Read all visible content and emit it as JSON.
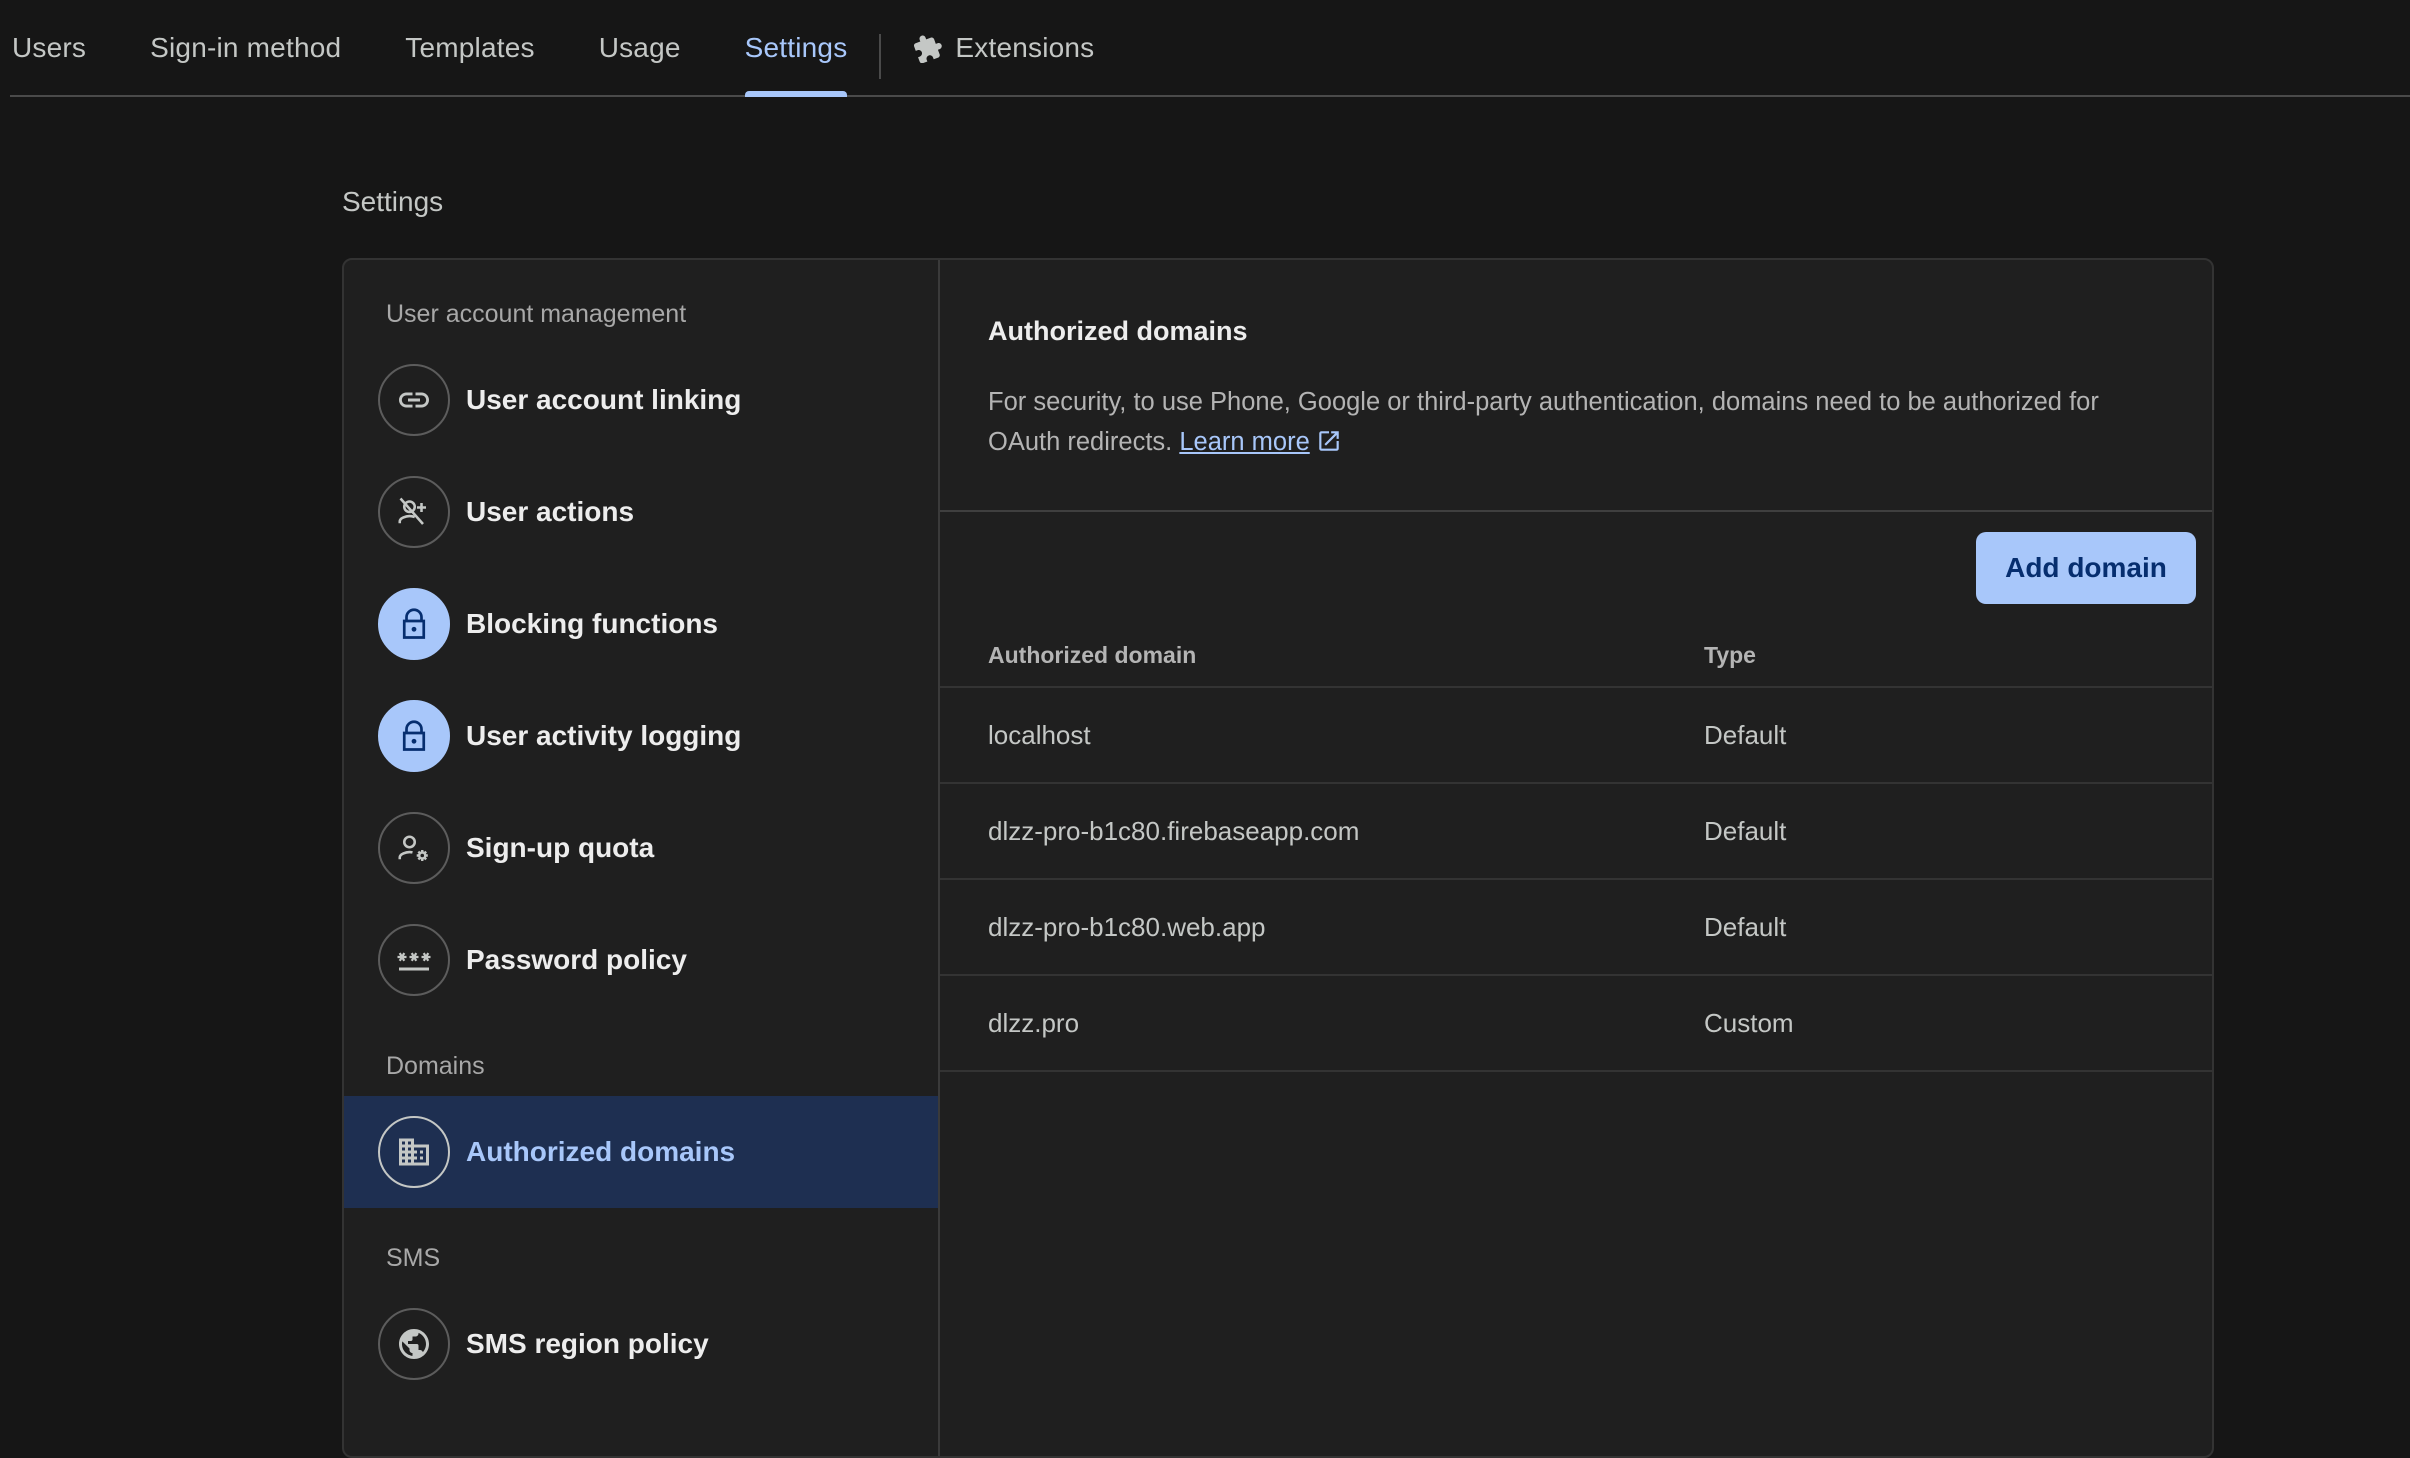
{
  "tabs": [
    {
      "label": "Users"
    },
    {
      "label": "Sign-in method"
    },
    {
      "label": "Templates"
    },
    {
      "label": "Usage"
    },
    {
      "label": "Settings"
    },
    {
      "label": "Extensions",
      "icon": "puzzle-piece-icon"
    }
  ],
  "active_tab": "Settings",
  "page": {
    "title": "Settings"
  },
  "sidebar": {
    "sections": [
      {
        "label": "User account management"
      },
      {
        "label": "Domains"
      },
      {
        "label": "SMS"
      }
    ],
    "items": [
      {
        "label": "User account linking",
        "icon": "link-icon"
      },
      {
        "label": "User actions",
        "icon": "person-off-icon"
      },
      {
        "label": "Blocking functions",
        "icon": "lock-icon"
      },
      {
        "label": "User activity logging",
        "icon": "lock-icon"
      },
      {
        "label": "Sign-up quota",
        "icon": "person-gear-icon"
      },
      {
        "label": "Password policy",
        "icon": "password-icon"
      },
      {
        "label": "Authorized domains",
        "icon": "domain-icon"
      },
      {
        "label": "SMS region policy",
        "icon": "globe-icon"
      }
    ],
    "selected": "Authorized domains"
  },
  "content": {
    "title": "Authorized domains",
    "description": "For security, to use Phone, Google or third-party authentication, domains need to be authorized for OAuth redirects.",
    "learn_more": "Learn more",
    "add_button": "Add domain",
    "table": {
      "headers": [
        "Authorized domain",
        "Type"
      ],
      "rows": [
        {
          "domain": "localhost",
          "type": "Default"
        },
        {
          "domain": "dlzz-pro-b1c80.firebaseapp.com",
          "type": "Default"
        },
        {
          "domain": "dlzz-pro-b1c80.web.app",
          "type": "Default"
        },
        {
          "domain": "dlzz.pro",
          "type": "Custom"
        }
      ]
    }
  },
  "colors": {
    "accent": "#a8c7fa",
    "selected_bg": "#1e2f51",
    "background": "#161616",
    "card": "#1f1f1f"
  }
}
